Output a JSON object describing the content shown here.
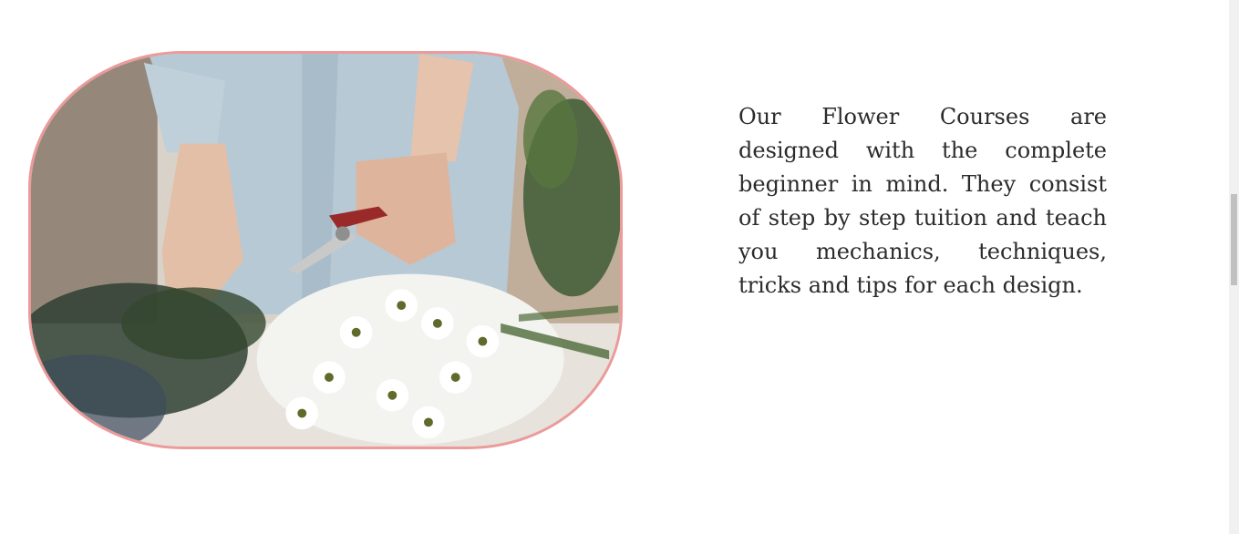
{
  "content": {
    "paragraph": "Our Flower Courses are designed with the complete beginner in mind. They consist of step by step tuition and teach you mechanics, techniques, tricks and tips for each design."
  },
  "image": {
    "alt": "Florist trimming flower stems with pruning shears beside a bunch of white daisies",
    "icon": "photo-florist"
  },
  "colors": {
    "frame_border": "#ec9a9a",
    "text": "#2b2b2b",
    "background": "#ffffff"
  }
}
